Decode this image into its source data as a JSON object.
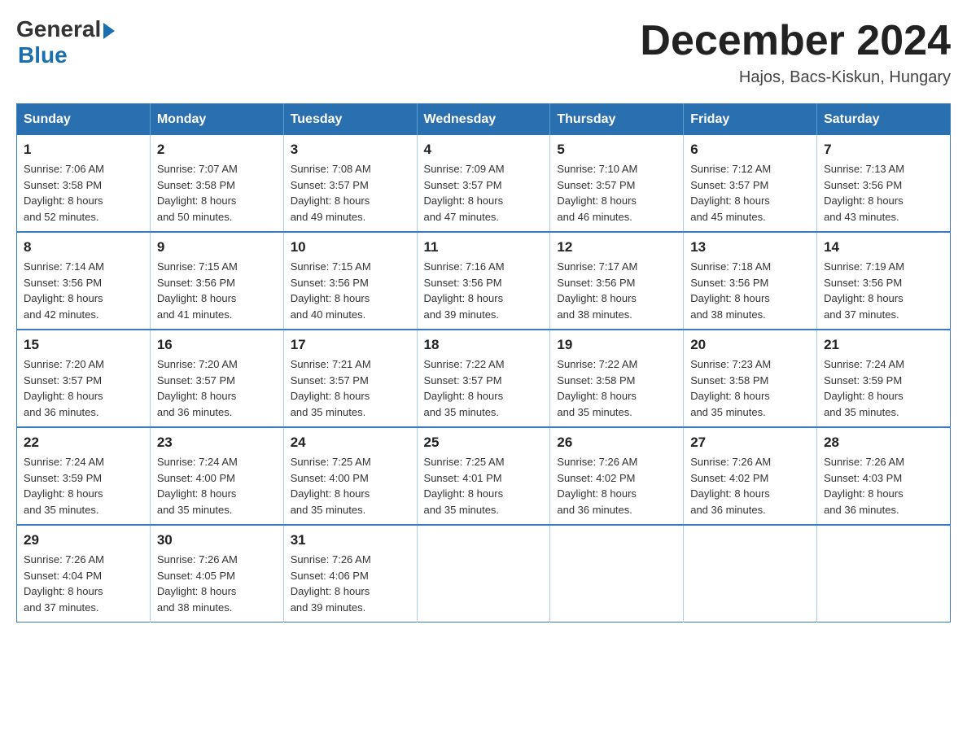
{
  "header": {
    "logo_general": "General",
    "logo_blue": "Blue",
    "month_title": "December 2024",
    "subtitle": "Hajos, Bacs-Kiskun, Hungary"
  },
  "days_of_week": [
    "Sunday",
    "Monday",
    "Tuesday",
    "Wednesday",
    "Thursday",
    "Friday",
    "Saturday"
  ],
  "weeks": [
    [
      {
        "day": "1",
        "sunrise": "7:06 AM",
        "sunset": "3:58 PM",
        "daylight": "8 hours and 52 minutes."
      },
      {
        "day": "2",
        "sunrise": "7:07 AM",
        "sunset": "3:58 PM",
        "daylight": "8 hours and 50 minutes."
      },
      {
        "day": "3",
        "sunrise": "7:08 AM",
        "sunset": "3:57 PM",
        "daylight": "8 hours and 49 minutes."
      },
      {
        "day": "4",
        "sunrise": "7:09 AM",
        "sunset": "3:57 PM",
        "daylight": "8 hours and 47 minutes."
      },
      {
        "day": "5",
        "sunrise": "7:10 AM",
        "sunset": "3:57 PM",
        "daylight": "8 hours and 46 minutes."
      },
      {
        "day": "6",
        "sunrise": "7:12 AM",
        "sunset": "3:57 PM",
        "daylight": "8 hours and 45 minutes."
      },
      {
        "day": "7",
        "sunrise": "7:13 AM",
        "sunset": "3:56 PM",
        "daylight": "8 hours and 43 minutes."
      }
    ],
    [
      {
        "day": "8",
        "sunrise": "7:14 AM",
        "sunset": "3:56 PM",
        "daylight": "8 hours and 42 minutes."
      },
      {
        "day": "9",
        "sunrise": "7:15 AM",
        "sunset": "3:56 PM",
        "daylight": "8 hours and 41 minutes."
      },
      {
        "day": "10",
        "sunrise": "7:15 AM",
        "sunset": "3:56 PM",
        "daylight": "8 hours and 40 minutes."
      },
      {
        "day": "11",
        "sunrise": "7:16 AM",
        "sunset": "3:56 PM",
        "daylight": "8 hours and 39 minutes."
      },
      {
        "day": "12",
        "sunrise": "7:17 AM",
        "sunset": "3:56 PM",
        "daylight": "8 hours and 38 minutes."
      },
      {
        "day": "13",
        "sunrise": "7:18 AM",
        "sunset": "3:56 PM",
        "daylight": "8 hours and 38 minutes."
      },
      {
        "day": "14",
        "sunrise": "7:19 AM",
        "sunset": "3:56 PM",
        "daylight": "8 hours and 37 minutes."
      }
    ],
    [
      {
        "day": "15",
        "sunrise": "7:20 AM",
        "sunset": "3:57 PM",
        "daylight": "8 hours and 36 minutes."
      },
      {
        "day": "16",
        "sunrise": "7:20 AM",
        "sunset": "3:57 PM",
        "daylight": "8 hours and 36 minutes."
      },
      {
        "day": "17",
        "sunrise": "7:21 AM",
        "sunset": "3:57 PM",
        "daylight": "8 hours and 35 minutes."
      },
      {
        "day": "18",
        "sunrise": "7:22 AM",
        "sunset": "3:57 PM",
        "daylight": "8 hours and 35 minutes."
      },
      {
        "day": "19",
        "sunrise": "7:22 AM",
        "sunset": "3:58 PM",
        "daylight": "8 hours and 35 minutes."
      },
      {
        "day": "20",
        "sunrise": "7:23 AM",
        "sunset": "3:58 PM",
        "daylight": "8 hours and 35 minutes."
      },
      {
        "day": "21",
        "sunrise": "7:24 AM",
        "sunset": "3:59 PM",
        "daylight": "8 hours and 35 minutes."
      }
    ],
    [
      {
        "day": "22",
        "sunrise": "7:24 AM",
        "sunset": "3:59 PM",
        "daylight": "8 hours and 35 minutes."
      },
      {
        "day": "23",
        "sunrise": "7:24 AM",
        "sunset": "4:00 PM",
        "daylight": "8 hours and 35 minutes."
      },
      {
        "day": "24",
        "sunrise": "7:25 AM",
        "sunset": "4:00 PM",
        "daylight": "8 hours and 35 minutes."
      },
      {
        "day": "25",
        "sunrise": "7:25 AM",
        "sunset": "4:01 PM",
        "daylight": "8 hours and 35 minutes."
      },
      {
        "day": "26",
        "sunrise": "7:26 AM",
        "sunset": "4:02 PM",
        "daylight": "8 hours and 36 minutes."
      },
      {
        "day": "27",
        "sunrise": "7:26 AM",
        "sunset": "4:02 PM",
        "daylight": "8 hours and 36 minutes."
      },
      {
        "day": "28",
        "sunrise": "7:26 AM",
        "sunset": "4:03 PM",
        "daylight": "8 hours and 36 minutes."
      }
    ],
    [
      {
        "day": "29",
        "sunrise": "7:26 AM",
        "sunset": "4:04 PM",
        "daylight": "8 hours and 37 minutes."
      },
      {
        "day": "30",
        "sunrise": "7:26 AM",
        "sunset": "4:05 PM",
        "daylight": "8 hours and 38 minutes."
      },
      {
        "day": "31",
        "sunrise": "7:26 AM",
        "sunset": "4:06 PM",
        "daylight": "8 hours and 39 minutes."
      },
      null,
      null,
      null,
      null
    ]
  ],
  "labels": {
    "sunrise": "Sunrise:",
    "sunset": "Sunset:",
    "daylight": "Daylight:"
  }
}
